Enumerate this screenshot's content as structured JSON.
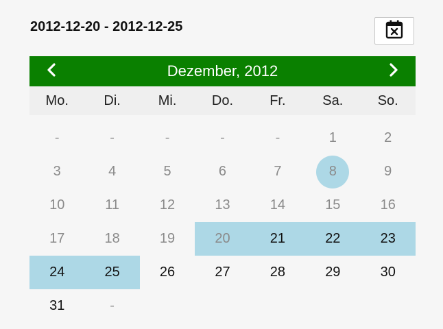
{
  "range_text": "2012-12-20 - 2012-12-25",
  "clear_button_icon": "calendar-clear-icon",
  "header": {
    "month_label": "Dezember, 2012",
    "prev_icon": "chevron-left-icon",
    "next_icon": "chevron-right-icon",
    "bg_color": "#0a8000"
  },
  "weekdays": [
    "Mo.",
    "Di.",
    "Mi.",
    "Do.",
    "Fr.",
    "Sa.",
    "So."
  ],
  "selection_color": "#add8e6",
  "days": [
    {
      "label": "-",
      "kind": "ph"
    },
    {
      "label": "-",
      "kind": "ph"
    },
    {
      "label": "-",
      "kind": "ph"
    },
    {
      "label": "-",
      "kind": "ph"
    },
    {
      "label": "-",
      "kind": "ph"
    },
    {
      "label": "1",
      "kind": "muted"
    },
    {
      "label": "2",
      "kind": "muted"
    },
    {
      "label": "3",
      "kind": "muted"
    },
    {
      "label": "4",
      "kind": "muted"
    },
    {
      "label": "5",
      "kind": "muted"
    },
    {
      "label": "6",
      "kind": "muted"
    },
    {
      "label": "7",
      "kind": "muted"
    },
    {
      "label": "8",
      "kind": "muted",
      "today": true
    },
    {
      "label": "9",
      "kind": "muted"
    },
    {
      "label": "10",
      "kind": "muted"
    },
    {
      "label": "11",
      "kind": "muted"
    },
    {
      "label": "12",
      "kind": "muted"
    },
    {
      "label": "13",
      "kind": "muted"
    },
    {
      "label": "14",
      "kind": "muted"
    },
    {
      "label": "15",
      "kind": "muted"
    },
    {
      "label": "16",
      "kind": "muted"
    },
    {
      "label": "17",
      "kind": "muted"
    },
    {
      "label": "18",
      "kind": "muted"
    },
    {
      "label": "19",
      "kind": "muted"
    },
    {
      "label": "20",
      "kind": "muted",
      "selected": true
    },
    {
      "label": "21",
      "kind": "dark",
      "selected": true
    },
    {
      "label": "22",
      "kind": "dark",
      "selected": true
    },
    {
      "label": "23",
      "kind": "dark",
      "selected": true
    },
    {
      "label": "24",
      "kind": "dark",
      "selected": true
    },
    {
      "label": "25",
      "kind": "dark",
      "selected": true
    },
    {
      "label": "26",
      "kind": "dark"
    },
    {
      "label": "27",
      "kind": "dark"
    },
    {
      "label": "28",
      "kind": "dark"
    },
    {
      "label": "29",
      "kind": "dark"
    },
    {
      "label": "30",
      "kind": "dark"
    },
    {
      "label": "31",
      "kind": "dark"
    },
    {
      "label": "-",
      "kind": "ph"
    }
  ]
}
